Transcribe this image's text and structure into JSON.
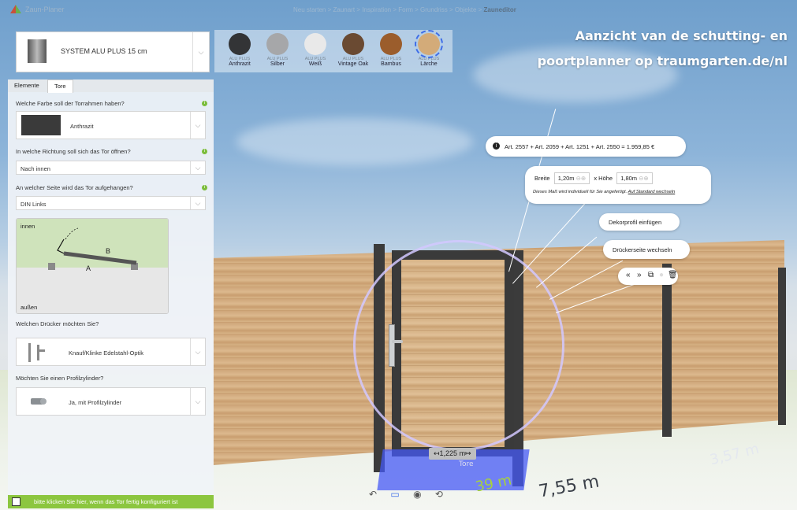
{
  "header": {
    "app_name": "Zaun-Planer",
    "breadcrumb": [
      "Neu starten",
      "Zaunart",
      "Inspiration",
      "Form",
      "Grundriss",
      "Objekte"
    ],
    "breadcrumb_sep": " > ",
    "breadcrumb_current": "Zauneditor"
  },
  "overlay": {
    "line1": "Aanzicht van de schutting- en",
    "line2": "poortplanner op traumgarten.de/nl"
  },
  "system": {
    "label": "SYSTEM ALU PLUS 15 cm"
  },
  "colors": [
    {
      "line1": "ALU PLUS",
      "line2": "Anthrazit",
      "hex": "#333436"
    },
    {
      "line1": "ALU PLUS",
      "line2": "Silber",
      "hex": "#a6a7a9"
    },
    {
      "line1": "ALU PLUS",
      "line2": "Weiß",
      "hex": "#e9e9e9"
    },
    {
      "line1": "ALU PLUS",
      "line2": "Vintage Oak",
      "hex": "#6a4a32"
    },
    {
      "line1": "ALU PLUS",
      "line2": "Bambus",
      "hex": "#9b5d2c"
    },
    {
      "line1": "ALU PLUS",
      "line2": "Lärche",
      "hex": "#d3ab79"
    }
  ],
  "tabs": [
    "Elemente",
    "Tore"
  ],
  "panel": {
    "q1": "Welche Farbe soll der Torrahmen haben?",
    "a1": "Anthrazit",
    "q2": "In welche Richtung soll sich das Tor öffnen?",
    "a2": "Nach innen",
    "q3": "An welcher Seite wird das Tor aufgehangen?",
    "a3": "DIN Links",
    "diagram": {
      "inside": "innen",
      "outside": "außen",
      "a": "A",
      "b": "B"
    },
    "q4": "Welchen Drücker möchten Sie?",
    "a4": "Knauf/Klinke Edelstahl-Optik",
    "q5": "Möchten Sie einen Profilzylinder?",
    "a5": "Ja, mit Profilzylinder"
  },
  "finish": {
    "label": "bitte klicken Sie hier, wenn das Tor fertig konfiguriert ist"
  },
  "price": {
    "text": "Art. 2557 + Art. 2059 + Art. 1251 + Art. 2550 = 1.959,85 €"
  },
  "dimensions": {
    "width_label": "Breite",
    "width_value": "1,20m",
    "times": "x",
    "height_label": "Höhe",
    "height_value": "1,80m",
    "note": "Dieses Maß wird individuell für Sie angefertigt.",
    "note_link": "Auf Standard wechseln"
  },
  "actions": {
    "decor": "Dekorprofil einfügen",
    "switch_side": "Drückerseite wechseln"
  },
  "measures": {
    "gate_width": "↤1,225 m↦",
    "gate_label": "Tore",
    "total": "7,55 m",
    "right": "3,57 m",
    "front": "39 m"
  },
  "icons": {
    "info": "info-icon",
    "undo": "undo-icon",
    "camera": "camera-icon",
    "rotate": "rotate-icon"
  }
}
